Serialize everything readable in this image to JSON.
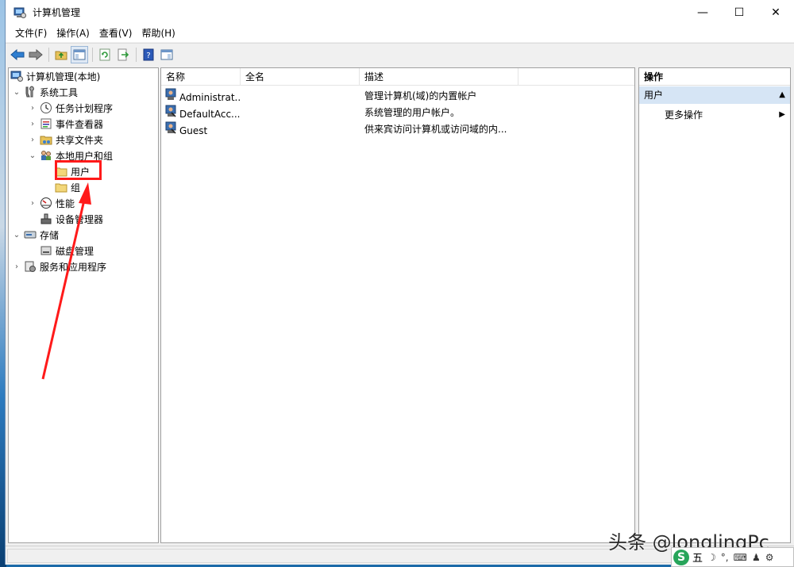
{
  "window": {
    "title": "计算机管理",
    "controls": {
      "minimize": "—",
      "maximize": "☐",
      "close": "✕"
    }
  },
  "menu": [
    "文件(F)",
    "操作(A)",
    "查看(V)",
    "帮助(H)"
  ],
  "tree": {
    "root": "计算机管理(本地)",
    "system_tools": "系统工具",
    "task_scheduler": "任务计划程序",
    "event_viewer": "事件查看器",
    "shared_folders": "共享文件夹",
    "local_users_groups": "本地用户和组",
    "users": "用户",
    "groups": "组",
    "performance": "性能",
    "device_manager": "设备管理器",
    "storage": "存储",
    "disk_management": "磁盘管理",
    "services_apps": "服务和应用程序"
  },
  "list": {
    "columns": [
      "名称",
      "全名",
      "描述"
    ],
    "rows": [
      {
        "name": "Administrat...",
        "full_name": "",
        "description": "管理计算机(域)的内置帐户"
      },
      {
        "name": "DefaultAcc...",
        "full_name": "",
        "description": "系统管理的用户帐户。"
      },
      {
        "name": "Guest",
        "full_name": "",
        "description": "供来宾访问计算机或访问域的内..."
      }
    ]
  },
  "actions": {
    "title": "操作",
    "group": "用户",
    "more": "更多操作"
  },
  "watermark": "头条 @longlingPc",
  "ime": {
    "logo": "S",
    "mode": "五",
    "symbols": [
      "☽",
      "°,",
      "⌨",
      "♟",
      "⚙"
    ]
  },
  "colors": {
    "highlight": "#ff1a1a",
    "selection": "#d6e5f5",
    "ime_logo": "#27a55a"
  }
}
